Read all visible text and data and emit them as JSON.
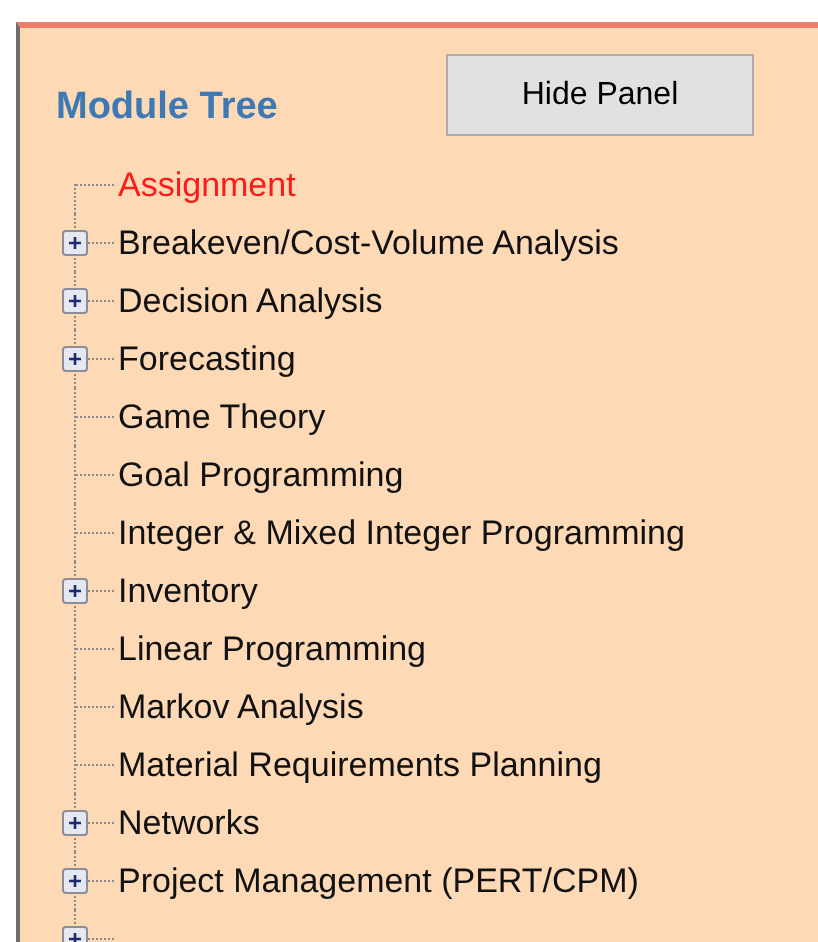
{
  "panel": {
    "title": "Module Tree",
    "hide_button": "Hide Panel"
  },
  "tree": [
    {
      "label": "Assignment",
      "kind": "leaf",
      "selected": true
    },
    {
      "label": "Breakeven/Cost-Volume Analysis",
      "kind": "group",
      "selected": false
    },
    {
      "label": "Decision Analysis",
      "kind": "group",
      "selected": false
    },
    {
      "label": "Forecasting",
      "kind": "group",
      "selected": false
    },
    {
      "label": "Game Theory",
      "kind": "leaf",
      "selected": false
    },
    {
      "label": "Goal Programming",
      "kind": "leaf",
      "selected": false
    },
    {
      "label": "Integer & Mixed Integer Programming",
      "kind": "leaf",
      "selected": false
    },
    {
      "label": "Inventory",
      "kind": "group",
      "selected": false
    },
    {
      "label": "Linear Programming",
      "kind": "leaf",
      "selected": false
    },
    {
      "label": "Markov Analysis",
      "kind": "leaf",
      "selected": false
    },
    {
      "label": "Material Requirements Planning",
      "kind": "leaf",
      "selected": false
    },
    {
      "label": "Networks",
      "kind": "group",
      "selected": false
    },
    {
      "label": "Project Management (PERT/CPM)",
      "kind": "group",
      "selected": false
    },
    {
      "kind": "group"
    }
  ]
}
